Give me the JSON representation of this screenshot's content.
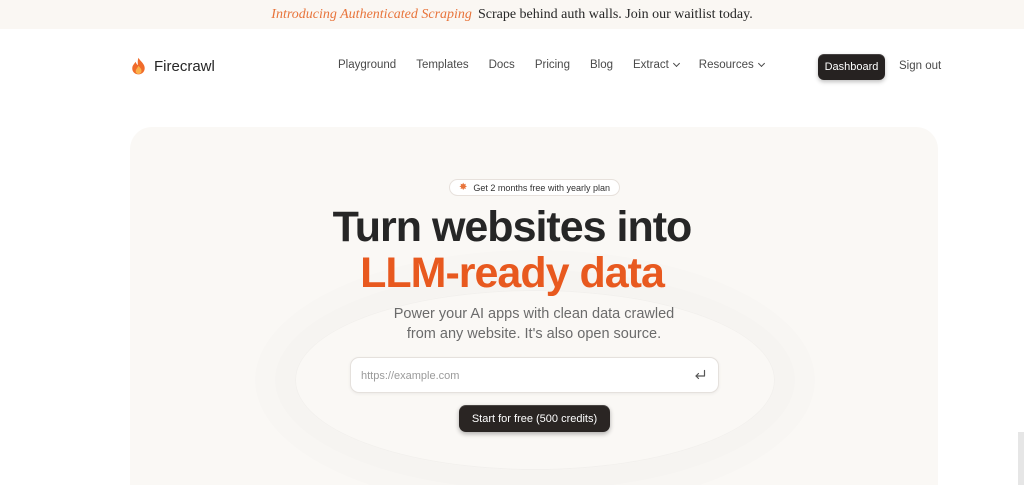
{
  "announcement": {
    "highlight": "Introducing Authenticated Scraping",
    "text": "Scrape behind auth walls. Join our waitlist today."
  },
  "nav": {
    "brand": "Firecrawl",
    "brand_icon": "flame-icon",
    "links": [
      {
        "label": "Playground"
      },
      {
        "label": "Templates"
      },
      {
        "label": "Docs"
      },
      {
        "label": "Pricing"
      },
      {
        "label": "Blog"
      },
      {
        "label": "Extract",
        "has_dropdown": true
      },
      {
        "label": "Resources",
        "has_dropdown": true
      }
    ],
    "dashboard_label": "Dashboard",
    "signout_label": "Sign out"
  },
  "hero": {
    "badge": "Get 2 months free with yearly plan",
    "title_line1": "Turn websites into",
    "title_line2": "LLM-ready data",
    "subtitle_line1": "Power your AI apps with clean data crawled",
    "subtitle_line2": "from any website. It's also open source.",
    "url_placeholder": "https://example.com",
    "cta_label": "Start for free (500 credits)"
  },
  "colors": {
    "accent": "#e8591f",
    "dark_button": "#262221",
    "hero_bg": "#faf8f5"
  }
}
